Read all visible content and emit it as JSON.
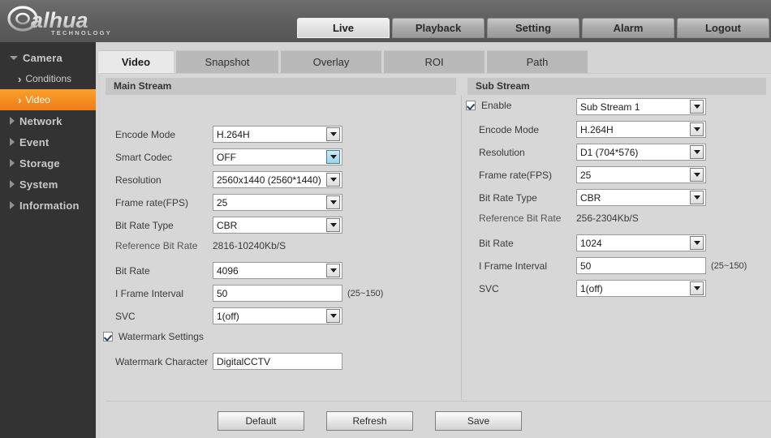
{
  "header": {
    "logo_text": "alhua",
    "logo_sub": "TECHNOLOGY",
    "nav": [
      {
        "label": "Live",
        "active": true
      },
      {
        "label": "Playback",
        "active": false
      },
      {
        "label": "Setting",
        "active": false
      },
      {
        "label": "Alarm",
        "active": false
      },
      {
        "label": "Logout",
        "active": false
      }
    ]
  },
  "sidebar": {
    "items": [
      {
        "label": "Camera",
        "type": "group-open"
      },
      {
        "label": "Conditions",
        "type": "sub"
      },
      {
        "label": "Video",
        "type": "sub-active"
      },
      {
        "label": "Network",
        "type": "group"
      },
      {
        "label": "Event",
        "type": "group"
      },
      {
        "label": "Storage",
        "type": "group"
      },
      {
        "label": "System",
        "type": "group"
      },
      {
        "label": "Information",
        "type": "group"
      }
    ]
  },
  "tabs": [
    {
      "label": "Video",
      "active": true
    },
    {
      "label": "Snapshot",
      "active": false
    },
    {
      "label": "Overlay",
      "active": false
    },
    {
      "label": "ROI",
      "active": false
    },
    {
      "label": "Path",
      "active": false
    }
  ],
  "main_stream": {
    "title": "Main Stream",
    "encode_mode": {
      "label": "Encode Mode",
      "value": "H.264H"
    },
    "smart_codec": {
      "label": "Smart Codec",
      "value": "OFF"
    },
    "resolution": {
      "label": "Resolution",
      "value": "2560x1440 (2560*1440)"
    },
    "frame_rate": {
      "label": "Frame rate(FPS)",
      "value": "25"
    },
    "bit_rate_type": {
      "label": "Bit Rate Type",
      "value": "CBR"
    },
    "reference_bit_rate": {
      "label": "Reference Bit Rate",
      "value": "2816-10240Kb/S"
    },
    "bit_rate": {
      "label": "Bit Rate",
      "value": "4096"
    },
    "i_frame_interval": {
      "label": "I Frame Interval",
      "value": "50",
      "hint": "(25~150)"
    },
    "svc": {
      "label": "SVC",
      "value": "1(off)"
    },
    "watermark_settings": {
      "label": "Watermark Settings",
      "checked": true
    },
    "watermark_character": {
      "label": "Watermark Character",
      "value": "DigitalCCTV"
    }
  },
  "sub_stream": {
    "title": "Sub Stream",
    "enable": {
      "label": "Enable",
      "checked": true,
      "value": "Sub Stream 1"
    },
    "encode_mode": {
      "label": "Encode Mode",
      "value": "H.264H"
    },
    "resolution": {
      "label": "Resolution",
      "value": "D1 (704*576)"
    },
    "frame_rate": {
      "label": "Frame rate(FPS)",
      "value": "25"
    },
    "bit_rate_type": {
      "label": "Bit Rate Type",
      "value": "CBR"
    },
    "reference_bit_rate": {
      "label": "Reference Bit Rate",
      "value": "256-2304Kb/S"
    },
    "bit_rate": {
      "label": "Bit Rate",
      "value": "1024"
    },
    "i_frame_interval": {
      "label": "I Frame Interval",
      "value": "50",
      "hint": "(25~150)"
    },
    "svc": {
      "label": "SVC",
      "value": "1(off)"
    }
  },
  "footer": {
    "default_label": "Default",
    "refresh_label": "Refresh",
    "save_label": "Save"
  },
  "colors": {
    "accent": "#f0851c",
    "header_bg": "#606060",
    "sidebar_bg": "#333333",
    "panel_bg": "#d7d7d7",
    "focus_blue": "#9ed4ea"
  }
}
